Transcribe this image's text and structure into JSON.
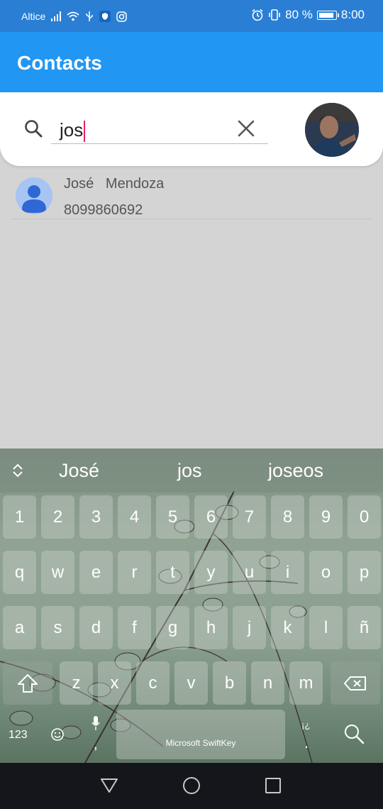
{
  "status_bar": {
    "carrier": "Altice",
    "battery_percent": "80 %",
    "time": "8:00",
    "icons": [
      "signal-icon",
      "wifi-icon",
      "usb-icon",
      "shield-app-icon",
      "instagram-icon",
      "alarm-icon",
      "vibrate-icon",
      "battery-icon"
    ]
  },
  "app_bar": {
    "title": "Contacts"
  },
  "search": {
    "query": "jos",
    "icons": [
      "search-icon",
      "clear-icon"
    ]
  },
  "contacts": [
    {
      "name": "José   Mendoza",
      "phone": "8099860692"
    }
  ],
  "keyboard": {
    "suggestions": [
      "José",
      "jos",
      "joseos"
    ],
    "number_row": [
      "1",
      "2",
      "3",
      "4",
      "5",
      "6",
      "7",
      "8",
      "9",
      "0"
    ],
    "row1": [
      "q",
      "w",
      "e",
      "r",
      "t",
      "y",
      "u",
      "i",
      "o",
      "p"
    ],
    "row2": [
      "a",
      "s",
      "d",
      "f",
      "g",
      "h",
      "j",
      "k",
      "l",
      "ñ"
    ],
    "row3": [
      "z",
      "x",
      "c",
      "v",
      "b",
      "n",
      "m"
    ],
    "symbols_key": "123",
    "space_label": "Microsoft SwiftKey",
    "punct_key": ".",
    "punct_key_alt": "¡¿",
    "comma_key": ","
  },
  "colors": {
    "status_bar": "#2a7fd4",
    "app_bar": "#2196f3",
    "caret": "#e91e63",
    "background": "#d4d4d4"
  }
}
